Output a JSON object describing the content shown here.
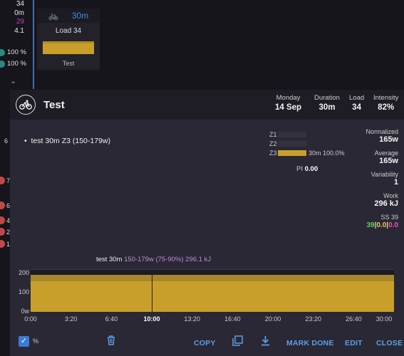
{
  "calendar": {
    "stats": [
      "34",
      "0m",
      "29",
      "4.1"
    ],
    "percents": [
      "100 %",
      "100 %"
    ],
    "card": {
      "duration": "30m",
      "load": "Load 34",
      "name": "Test"
    },
    "side_numbers": [
      "6",
      "7",
      "6",
      "4",
      "2",
      "1"
    ]
  },
  "dialog": {
    "title": "Test",
    "header": {
      "day_label": "Monday",
      "day_value": "14 Sep",
      "duration_label": "Duration",
      "duration_value": "30m",
      "load_label": "Load",
      "load_value": "34",
      "intensity_label": "Intensity",
      "intensity_value": "82%"
    },
    "workout_steps": [
      "test 30m Z3 (150-179w)"
    ],
    "zones": [
      {
        "label": "Z1",
        "fraction": 0,
        "text": ""
      },
      {
        "label": "Z2",
        "fraction": 0,
        "text": ""
      },
      {
        "label": "Z3",
        "fraction": 1,
        "text": "30m 100.0%"
      }
    ],
    "pi_label": "PI",
    "pi_value": "0.00",
    "metrics": {
      "normalized_label": "Normalized",
      "normalized_value": "165w",
      "average_label": "Average",
      "average_value": "165w",
      "variability_label": "Variability",
      "variability_value": "1",
      "work_label": "Work",
      "work_value": "296 kJ",
      "ss_label": "SS 39",
      "ss_values": [
        "39",
        "0.0",
        "0.0"
      ],
      "ss_colors": [
        "#5fd35f",
        "#e8c84a",
        "#e85aa0"
      ]
    },
    "chart_label": {
      "name": "test 30m",
      "detail": "150-179w (75-90%)",
      "energy": "296.1 kJ"
    },
    "chart_data": {
      "type": "area",
      "y_ticks": [
        "200",
        "100",
        "0w"
      ],
      "x_ticks": [
        "0:00",
        "3:20",
        "6:40",
        "10:00",
        "13:20",
        "16:40",
        "20:00",
        "23:20",
        "26:40",
        "30:00"
      ],
      "highlight_tick": "10:00",
      "series": [
        {
          "x_start": "0:00",
          "x_end": "30:00",
          "low": 150,
          "high": 179
        }
      ],
      "ylim": [
        0,
        200
      ]
    },
    "footer": {
      "percent_label": "%",
      "copy": "COPY",
      "mark_done": "MARK DONE",
      "edit": "EDIT",
      "close": "CLOSE"
    }
  }
}
